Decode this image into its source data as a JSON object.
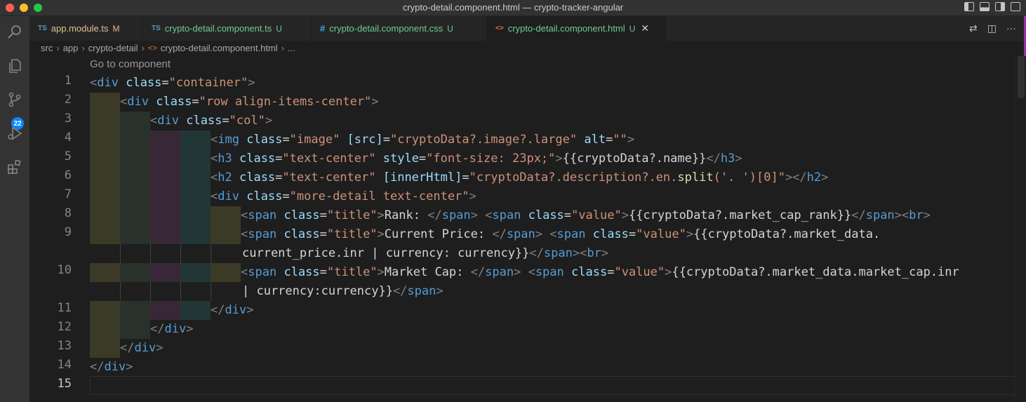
{
  "window": {
    "title": "crypto-detail.component.html — crypto-tracker-angular"
  },
  "activity_bar": {
    "items": [
      {
        "icon": "search-icon"
      },
      {
        "icon": "files-icon"
      },
      {
        "icon": "source-control-icon",
        "badge": "22"
      },
      {
        "icon": "run-debug-icon"
      },
      {
        "icon": "extensions-icon"
      }
    ]
  },
  "tabs": [
    {
      "ext": "TS",
      "label": "app.module.ts",
      "status": "M",
      "label_color": "#e2c08d",
      "status_color": "#e2c08d",
      "ext_color": "#519aba"
    },
    {
      "ext": "TS",
      "label": "crypto-detail.component.ts",
      "status": "U",
      "label_color": "#73c991",
      "status_color": "#73c991",
      "ext_color": "#519aba"
    },
    {
      "ext": "#",
      "label": "crypto-detail.component.css",
      "status": "U",
      "label_color": "#73c991",
      "status_color": "#73c991",
      "ext_color": "#42a5f5"
    },
    {
      "ext": "<>",
      "label": "crypto-detail.component.html",
      "status": "U",
      "label_color": "#73c991",
      "status_color": "#73c991",
      "ext_color": "#e37933",
      "active": true
    }
  ],
  "breadcrumb": [
    "src",
    "app",
    "crypto-detail",
    "crypto-detail.component.html",
    "..."
  ],
  "codelens": "Go to component",
  "line_numbers": [
    "1",
    "2",
    "3",
    "4",
    "5",
    "6",
    "7",
    "8",
    "9",
    "",
    "10",
    "",
    "11",
    "12",
    "13",
    "14",
    "15"
  ],
  "code": {
    "l1": {
      "a": "<",
      "b": "div",
      "c": "class",
      "d": "=",
      "e": "\"container\"",
      "f": ">"
    },
    "l2": {
      "a": "<",
      "b": "div",
      "c": "class",
      "d": "=",
      "e": "\"row align-items-center\"",
      "f": ">"
    },
    "l3": {
      "a": "<",
      "b": "div",
      "c": "class",
      "d": "=",
      "e": "\"col\"",
      "f": ">"
    },
    "l4": {
      "a": "<",
      "b": "img",
      "c": "class",
      "d": "=",
      "e": "\"image\"",
      "g": "[src]",
      "h": "=",
      "i": "\"cryptoData?.image?.large\"",
      "j": "alt",
      "k": "=",
      "l": "\"\"",
      "m": ">"
    },
    "l5": {
      "a": "<",
      "b": "h3",
      "c": "class",
      "d": "=",
      "e": "\"text-center\"",
      "g": "style",
      "h": "=",
      "i": "\"font-size: 23px;\"",
      "j": ">",
      "k": "{{cryptoData?.name}}",
      "l": "</",
      "m": "h3",
      "n": ">"
    },
    "l6": {
      "a": "<",
      "b": "h2",
      "c": "class",
      "d": "=",
      "e": "\"text-center\"",
      "g": "[innerHtml]",
      "h": "=",
      "i1": "\"cryptoData?.description?.en.",
      "i2": "split",
      "i3": "('. ')[0]\"",
      "j": "></",
      "k": "h2",
      "l": ">"
    },
    "l7": {
      "a": "<",
      "b": "div",
      "c": "class",
      "d": "=",
      "e": "\"more-detail text-center\"",
      "f": ">"
    },
    "l8": {
      "a": "<",
      "b": "span",
      "c": "class",
      "d": "=",
      "e": "\"title\"",
      "f": ">",
      "t": "Rank: ",
      "g": "</",
      "h": "span",
      "i": ">",
      "j": "<",
      "k": "span",
      "l": "class",
      "m": "=",
      "n": "\"value\"",
      "o": ">",
      "p": "{{cryptoData?.market_cap_rank}}",
      "q": "</",
      "r": "span",
      "s": "><",
      "u": "br",
      "v": ">"
    },
    "l9": {
      "a": "<",
      "b": "span",
      "c": "class",
      "d": "=",
      "e": "\"title\"",
      "f": ">",
      "t": "Current Price: ",
      "g": "</",
      "h": "span",
      "i": ">",
      "j": "<",
      "k": "span",
      "l": "class",
      "m": "=",
      "n": "\"value\"",
      "o": ">",
      "p": "{{cryptoData?.market_data."
    },
    "l9b": {
      "p": "current_price.inr | currency: currency}}",
      "q": "</",
      "r": "span",
      "s": "><",
      "u": "br",
      "v": ">"
    },
    "l10": {
      "a": "<",
      "b": "span",
      "c": "class",
      "d": "=",
      "e": "\"title\"",
      "f": ">",
      "t": "Market Cap: ",
      "g": "</",
      "h": "span",
      "i": ">",
      "j": "<",
      "k": "span",
      "l": "class",
      "m": "=",
      "n": "\"value\"",
      "o": ">",
      "p": "{{cryptoData?.market_data.market_cap.inr"
    },
    "l10b": {
      "p": "| currency:currency}}",
      "q": "</",
      "r": "span",
      "s": ">"
    },
    "l11": {
      "a": "</",
      "b": "div",
      "c": ">"
    },
    "l12": {
      "a": "</",
      "b": "div",
      "c": ">"
    },
    "l13": {
      "a": "</",
      "b": "div",
      "c": ">"
    },
    "l14": {
      "a": "</",
      "b": "div",
      "c": ">"
    }
  }
}
